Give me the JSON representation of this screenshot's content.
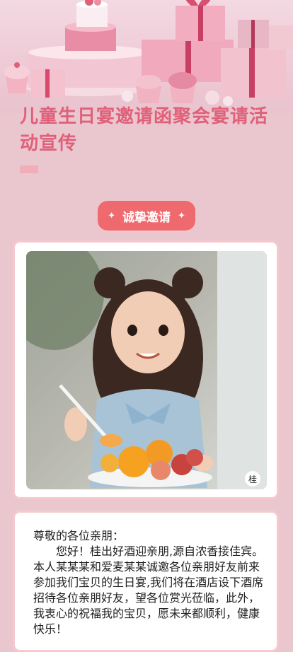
{
  "page": {
    "title": "儿童生日宴邀请函聚会宴请活动宣传",
    "invite_button": "诚挚邀请",
    "letter": {
      "greeting": "尊敬的各位亲朋：",
      "body": "您好！桂出好酒迎亲朋,源自浓香接佳宾。本人某某某和爱麦某某诚邀各位亲朋好友前来参加我们宝贝的生日宴,我们将在酒店设下酒席招待各位亲朋好友，望各位赏光莅临，此外，我衷心的祝福我的宝贝，愿未来都顺利，健康快乐！"
    }
  },
  "colors": {
    "background": "#eac6ce",
    "title": "#e0607a",
    "accent_button": "#ee6a6f",
    "card_border": "#f7c9ce"
  },
  "icons": [
    "sparkle-icon",
    "watermark-seal-icon"
  ]
}
